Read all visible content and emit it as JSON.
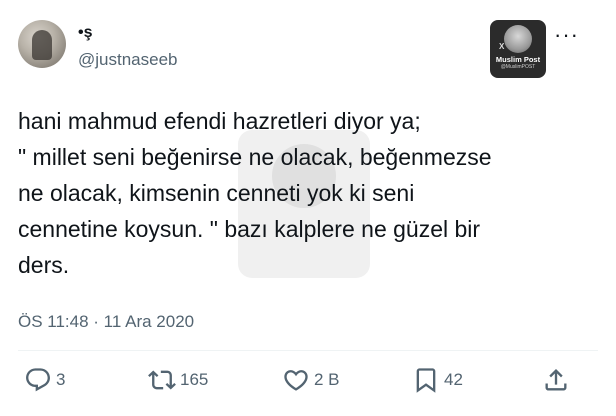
{
  "author": {
    "name": "•ş",
    "handle": "@justnaseeb"
  },
  "badge": {
    "title": "Muslim Post",
    "subtitle": "@MuslimPOST",
    "x_mark": "X"
  },
  "tweet": {
    "lines": [
      "hani mahmud efendi hazretleri diyor ya;",
      "\" millet seni beğenirse ne olacak, beğenmezse",
      "ne olacak, kimsenin cenneti yok ki seni",
      "cennetine koysun. \" bazı kalplere ne güzel bir",
      "ders."
    ],
    "timestamp": "ÖS 11:48 · 11 Ara 2020"
  },
  "actions": {
    "replies": "3",
    "retweets": "165",
    "likes": "2 B",
    "bookmarks": "42"
  },
  "more_label": "···"
}
